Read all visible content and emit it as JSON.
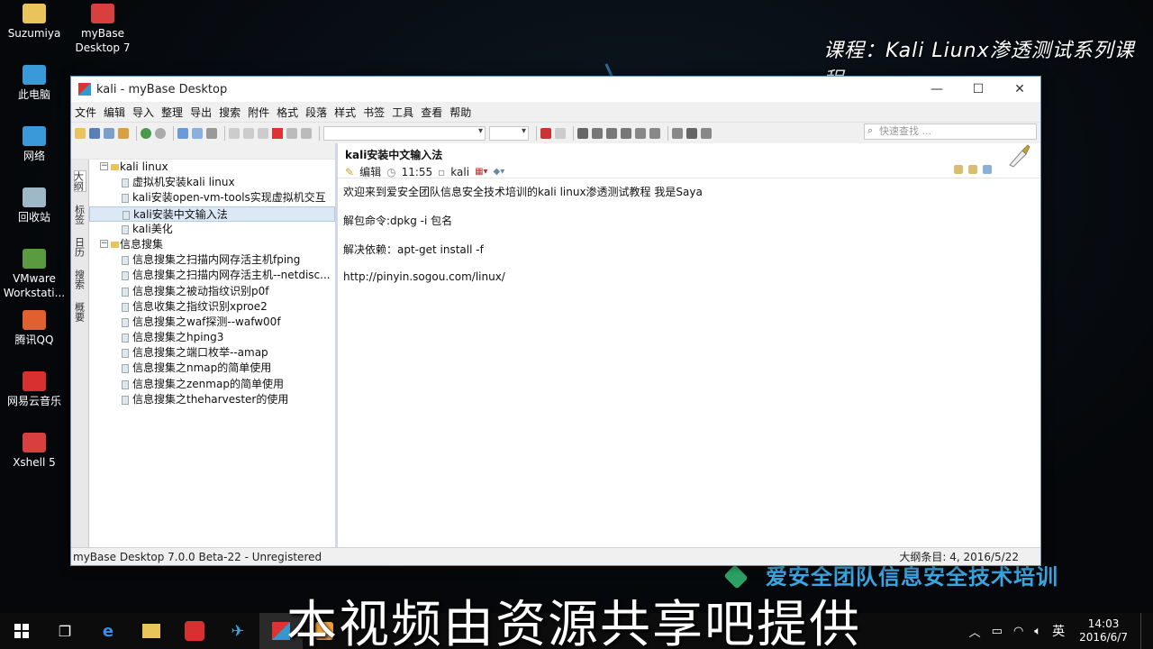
{
  "desktop_icons": [
    {
      "label": "Suzumiya",
      "color": "#e8c45a"
    },
    {
      "label": "myBase\nDesktop 7",
      "color": "#d84040"
    },
    {
      "label": "此电脑",
      "color": "#3a9ad9"
    },
    {
      "label": "网络",
      "color": "#3a9ad9"
    },
    {
      "label": "回收站",
      "color": "#9fb8c8"
    },
    {
      "label": "VMware\nWorkstati...",
      "color": "#5a9a40"
    },
    {
      "label": "腾讯QQ",
      "color": "#e06030"
    },
    {
      "label": "网易云音乐",
      "color": "#d83030"
    },
    {
      "label": "Xshell 5",
      "color": "#d84040"
    }
  ],
  "watermark": {
    "top": "课程：Kali Liunx渗透测试系列课程",
    "bottom": "爱安全团队信息安全技术培训"
  },
  "subtitle": "本视频由资源共享吧提供",
  "window": {
    "title": "kali - myBase Desktop",
    "minimize": "—",
    "maximize": "☐",
    "close": "✕",
    "menu": [
      "文件",
      "编辑",
      "导入",
      "整理",
      "导出",
      "搜索",
      "附件",
      "格式",
      "段落",
      "样式",
      "书签",
      "工具",
      "查看",
      "帮助"
    ],
    "quick_search_placeholder": "快速查找 ..."
  },
  "side_tabs": [
    "大纲",
    "标签",
    "日历",
    "搜索",
    "概要"
  ],
  "tree": [
    {
      "label": "kali linux",
      "level": 0,
      "expanded": true
    },
    {
      "label": "虚拟机安装kali linux",
      "level": 1
    },
    {
      "label": "kali安装open-vm-tools实现虚拟机交互",
      "level": 1
    },
    {
      "label": "kali安装中文输入法",
      "level": 1,
      "selected": true
    },
    {
      "label": "kali美化",
      "level": 1
    },
    {
      "label": "信息搜集",
      "level": 0,
      "expanded": true
    },
    {
      "label": "信息搜集之扫描内网存活主机fping",
      "level": 1
    },
    {
      "label": "信息搜集之扫描内网存活主机--netdisc...",
      "level": 1
    },
    {
      "label": "信息搜集之被动指纹识别p0f",
      "level": 1
    },
    {
      "label": "信息收集之指纹识别xproe2",
      "level": 1
    },
    {
      "label": "信息搜集之waf探测--wafw00f",
      "level": 1
    },
    {
      "label": "信息搜集之hping3",
      "level": 1
    },
    {
      "label": "信息搜集之端口枚举--amap",
      "level": 1
    },
    {
      "label": "信息搜集之nmap的简单使用",
      "level": 1
    },
    {
      "label": "信息搜集之zenmap的简单使用",
      "level": 1
    },
    {
      "label": "信息搜集之theharvester的使用",
      "level": 1
    }
  ],
  "document": {
    "title": "kali安装中文输入法",
    "edit_label": "编辑",
    "time": "11:55",
    "author": "kali",
    "lines": [
      "欢迎来到爱安全团队信息安全技术培训的kali linux渗透测试教程 我是Saya",
      "解包命令:dpkg -i 包名",
      "解决依赖：apt-get install -f",
      "http://pinyin.sogou.com/linux/"
    ]
  },
  "status": {
    "left": "myBase Desktop 7.0.0 Beta-22 - Unregistered",
    "right": "大纲条目: 4, 2016/5/22"
  },
  "taskbar": {
    "ime": "英",
    "time": "14:03",
    "date": "2016/6/7"
  }
}
